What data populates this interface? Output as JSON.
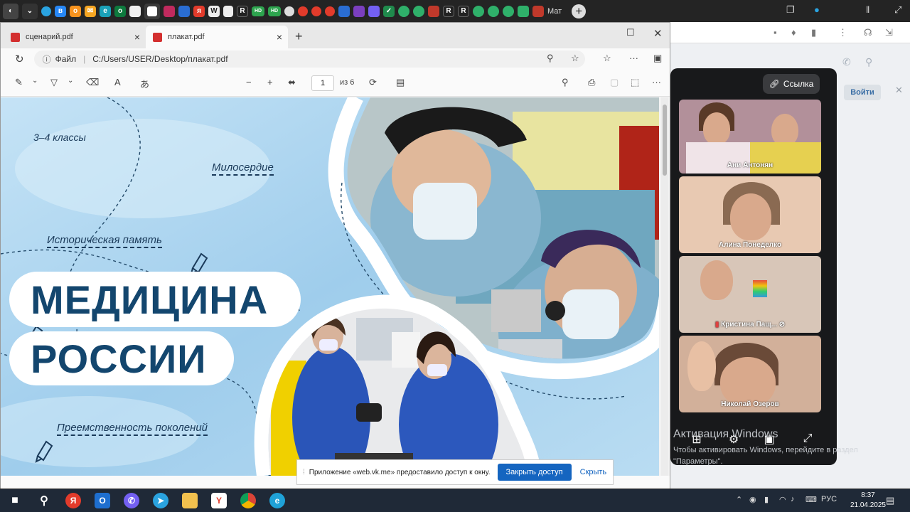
{
  "top_tabs": {
    "mat_label": "Мат",
    "icons": [
      "tab-prism-icon",
      "tab-chevron-icon",
      "telegram-icon",
      "vk-icon",
      "ok-icon",
      "mail-icon",
      "edge-tab-icon",
      "ozon-icon",
      "doc-icon",
      "active-tab-icon",
      "audio-icon",
      "tab-ms-icon",
      "tab-ya-icon",
      "tab-word-icon",
      "tab-doc-icon",
      "tab-r-icon",
      "tab-hd-icon",
      "tab-hd2-icon",
      "tab-tiktok-icon",
      "tab-ya2-icon",
      "tab-ya3-icon",
      "tab-ya4-icon",
      "tab-ms2-icon",
      "tab-chat-icon",
      "tab-viber-icon",
      "tab-check-icon",
      "tab-flower-icon",
      "tab-flower2-icon",
      "tab-ms3-icon",
      "tab-r2-icon",
      "tab-r3-icon",
      "tab-flower3-icon",
      "tab-flower4-icon",
      "tab-flower5-icon",
      "tab-ms4-icon",
      "tab-ms5-icon"
    ]
  },
  "edge": {
    "tabs": [
      {
        "label": "сценарий.pdf",
        "selected": false
      },
      {
        "label": "плакат.pdf",
        "selected": true
      }
    ],
    "address": {
      "scheme_label": "Файл",
      "path": "C:/Users/USER/Desktop/плакат.pdf"
    },
    "pdf_toolbar": {
      "page_current": "1",
      "page_of": "из 6"
    }
  },
  "poster": {
    "grade": "3–4 классы",
    "topic_1": "Милосердие",
    "topic_2": "Историческая память",
    "topic_3": "Преемственность поколений",
    "title_1": "МЕДИЦИНА",
    "title_2": "РОССИИ"
  },
  "vk": {
    "link_label": "Ссылка",
    "join_label": "Войти",
    "participants": [
      {
        "name": "Ани Антонян"
      },
      {
        "name": "Алина Понеделко"
      },
      {
        "name": "Кристина Пащ..."
      },
      {
        "name": "Николай Озеров"
      }
    ]
  },
  "share_bar": {
    "message": "Приложение «web.vk.me» предоставило доступ к окну.",
    "stop_label": "Закрыть доступ",
    "hide_label": "Скрыть"
  },
  "windows": {
    "watermark_title": "Активация Windows",
    "watermark_text": "Чтобы активировать Windows, перейдите в раздел \"Параметры\".",
    "tray_lang": "РУС",
    "time": "8:37",
    "date": "21.04.2025"
  },
  "colors": {
    "accent": "#1565c0",
    "poster_title": "#13466e",
    "poster_bg": "#a9d4ef"
  }
}
